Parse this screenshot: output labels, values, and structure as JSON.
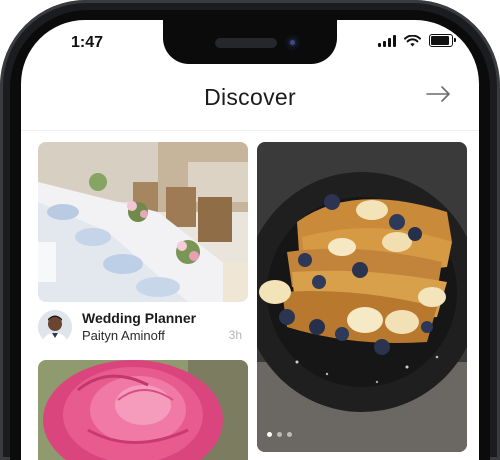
{
  "status_bar": {
    "time": "1:47",
    "icons": [
      "signal-icon",
      "wifi-icon",
      "battery-icon"
    ]
  },
  "header": {
    "title": "Discover",
    "action_icon": "arrow-right-icon"
  },
  "feed": {
    "cards": [
      {
        "image": "wedding-reception-tables",
        "title": "Wedding Planner",
        "author": "Paityn Aminoff",
        "time": "3h",
        "avatar": "person-avatar"
      },
      {
        "image": "french-toast-with-blueberries-and-bananas",
        "pager": {
          "count": 3,
          "active": 1
        }
      },
      {
        "image": "pink-peony-flower"
      }
    ]
  },
  "colors": {
    "frame": "#1b1c1f",
    "screen": "#ffffff",
    "title_text": "#1b1b1b",
    "muted_text": "#b5b5b5"
  }
}
